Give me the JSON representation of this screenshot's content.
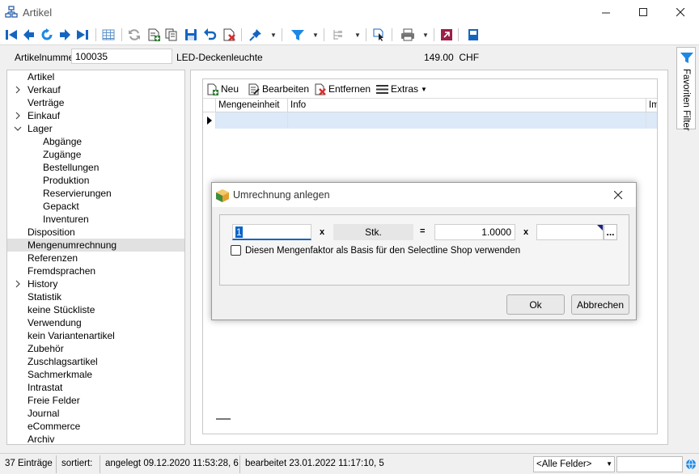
{
  "window": {
    "title": "Artikel",
    "minimize_icon": "minimize-icon",
    "maximize_icon": "maximize-icon",
    "close_icon": "close-icon"
  },
  "header": {
    "artikelnummer_label": "Artikelnummer",
    "artikelnummer_value": "100035",
    "description": "LED-Deckenleuchte",
    "price": "149.00",
    "currency": "CHF"
  },
  "tree": {
    "items": [
      {
        "label": "Artikel",
        "level": 0,
        "expander": ""
      },
      {
        "label": "Verkauf",
        "level": 0,
        "expander": "collapsed"
      },
      {
        "label": "Verträge",
        "level": 0,
        "expander": ""
      },
      {
        "label": "Einkauf",
        "level": 0,
        "expander": "collapsed"
      },
      {
        "label": "Lager",
        "level": 0,
        "expander": "expanded"
      },
      {
        "label": "Abgänge",
        "level": 1,
        "expander": ""
      },
      {
        "label": "Zugänge",
        "level": 1,
        "expander": ""
      },
      {
        "label": "Bestellungen",
        "level": 1,
        "expander": ""
      },
      {
        "label": "Produktion",
        "level": 1,
        "expander": ""
      },
      {
        "label": "Reservierungen",
        "level": 1,
        "expander": ""
      },
      {
        "label": "Gepackt",
        "level": 1,
        "expander": ""
      },
      {
        "label": "Inventuren",
        "level": 1,
        "expander": ""
      },
      {
        "label": "Disposition",
        "level": 0,
        "expander": ""
      },
      {
        "label": "Mengenumrechnung",
        "level": 0,
        "expander": "",
        "selected": true
      },
      {
        "label": "Referenzen",
        "level": 0,
        "expander": ""
      },
      {
        "label": "Fremdsprachen",
        "level": 0,
        "expander": ""
      },
      {
        "label": "History",
        "level": 0,
        "expander": "collapsed"
      },
      {
        "label": "Statistik",
        "level": 0,
        "expander": ""
      },
      {
        "label": "keine Stückliste",
        "level": 0,
        "expander": ""
      },
      {
        "label": "Verwendung",
        "level": 0,
        "expander": ""
      },
      {
        "label": "kein Variantenartikel",
        "level": 0,
        "expander": ""
      },
      {
        "label": "Zubehör",
        "level": 0,
        "expander": ""
      },
      {
        "label": "Zuschlagsartikel",
        "level": 0,
        "expander": ""
      },
      {
        "label": "Sachmerkmale",
        "level": 0,
        "expander": ""
      },
      {
        "label": "Intrastat",
        "level": 0,
        "expander": ""
      },
      {
        "label": "Freie Felder",
        "level": 0,
        "expander": ""
      },
      {
        "label": "Journal",
        "level": 0,
        "expander": ""
      },
      {
        "label": "eCommerce",
        "level": 0,
        "expander": ""
      },
      {
        "label": "Archiv",
        "level": 0,
        "expander": ""
      }
    ]
  },
  "grid": {
    "toolbar": {
      "neu": "Neu",
      "bearbeiten": "Bearbeiten",
      "entfernen": "Entfernen",
      "extras": "Extras"
    },
    "columns": [
      "Mengeneinheit",
      "Info",
      "Im"
    ]
  },
  "dialog": {
    "title": "Umrechnung anlegen",
    "quantity_value": "1",
    "multiply_symbol": "x",
    "unit_label": "Stk.",
    "equals_symbol": "=",
    "factor_value": "1.0000",
    "multiply_symbol_2": "x",
    "unit_target_value": "",
    "browse_label": "...",
    "checkbox_label": "Diesen Mengenfaktor als Basis für den Selectline Shop verwenden",
    "checkbox_checked": false,
    "ok_label": "Ok",
    "cancel_label": "Abbrechen"
  },
  "side_panel": {
    "favoriten_filter": "Favoriten Filter"
  },
  "status": {
    "count": "37 Einträge",
    "sorted_label": "sortiert:",
    "created": "angelegt 09.12.2020 11:53:28,  6",
    "edited": "bearbeitet 23.01.2022 11:17:10,  5",
    "field_select": "<Alle Felder>",
    "search_value": ""
  },
  "colors": {
    "accent_blue": "#1565c0",
    "selection_row": "#dce9f9",
    "tree_selected": "#e1e1e1"
  }
}
